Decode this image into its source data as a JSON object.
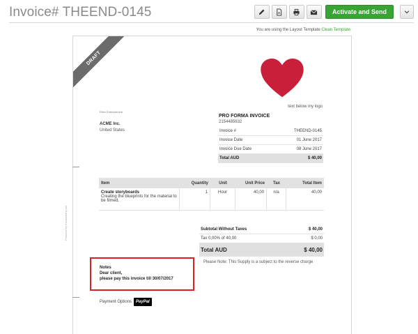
{
  "header": {
    "title": "Invoice# THEEND-0145",
    "activate_label": "Activate and Send",
    "icons": [
      "pencil-icon",
      "pdf-icon",
      "print-icon",
      "email-icon",
      "chevron-down-icon"
    ]
  },
  "template_notice": {
    "prefix": "You are using the Layout Template",
    "link": "Clean Template"
  },
  "document": {
    "ribbon": "DRAFT",
    "powered_by": "Powered by Invoiceberry.net",
    "logo_caption": "text below my logo",
    "logo_color": "#c8203a",
    "company_small": "Ellen Entrepreneur",
    "client": {
      "name": "ACME Inc.",
      "country": "United States"
    },
    "proforma": {
      "title": "PRO FORMA INVOICE",
      "number": "2154485632"
    },
    "meta": [
      {
        "label": "Invoice #",
        "value": "THEEND-0145"
      },
      {
        "label": "Invoice Date",
        "value": "01 June 2017"
      },
      {
        "label": "Invoice Due Date",
        "value": "08 June 2017"
      },
      {
        "label": "Total AUD",
        "value": "$ 40,00"
      }
    ],
    "items_header": {
      "item": "Item",
      "qty": "Quantity",
      "unit": "Unit",
      "price": "Unit Price",
      "tax": "Tax",
      "total": "Total Item"
    },
    "items": [
      {
        "name": "Create storyboards",
        "desc": "Creating the blueprints for the material to be filmed.",
        "qty": "1",
        "unit": "Hour",
        "price": "40,00",
        "tax": "n/a",
        "total": "40,00"
      }
    ],
    "summary": {
      "subtotal_label": "Subtotal Without Taxes",
      "subtotal_value": "$ 40,00",
      "tax_label": "Tax 0,00% of 40,00",
      "tax_value": "$ 0,00",
      "total_label": "Total AUD",
      "total_value": "$ 40,00"
    },
    "reverse_charge": "Please Note: This Supply is a subject to the reverse charge",
    "notes": {
      "title": "Notes",
      "line1": "Dear client,",
      "line2": "please pay this invoice till 30/07/2017",
      "highlight_color": "#e02020"
    },
    "payment": {
      "label": "Payment Options",
      "paypal": "PayPal"
    }
  },
  "colors": {
    "accent_green": "#3aa335",
    "title_gray": "#8a8a8a"
  }
}
